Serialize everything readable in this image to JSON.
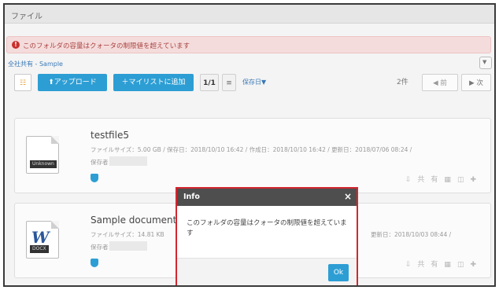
{
  "titlebar": {
    "title": "ファイル"
  },
  "alert": {
    "icon": "error-icon",
    "text": "このフォルダの容量はクォータの制限値を超えています"
  },
  "breadcrumb": {
    "text": "全社共有 - Sample"
  },
  "toolbar": {
    "upload": "⬆アップロード",
    "add_mylist": "＋マイリストに追加",
    "page": "1/1",
    "sort": "保存日▼",
    "count": "2件",
    "prev": "◀ 前",
    "next": "▶ 次"
  },
  "files": [
    {
      "name": "testfile5",
      "badge": "Unknown",
      "meta": "ファイルサイズ：5.00 GB / 保存日：2018/10/10 16:42 / 作成日：2018/10/10 16:42 / 更新日：2018/07/06 08:24 /",
      "saver": "保存者："
    },
    {
      "name": "Sample document.d",
      "badge": "DOCX",
      "meta_left": "ファイルサイズ：14.81 KB",
      "meta_right": "更新日：2018/10/03 08:44 /",
      "saver": "保存者："
    }
  ],
  "actions_text": "共有",
  "modal": {
    "title": "Info",
    "message": "このフォルダの容量はクォータの制限値を超えています",
    "ok": "Ok"
  },
  "colors": {
    "accent": "#2d9ed4",
    "alert_bg": "#f5dcdc",
    "modal_border": "#d3262f",
    "modal_header": "#4e4e4e"
  }
}
